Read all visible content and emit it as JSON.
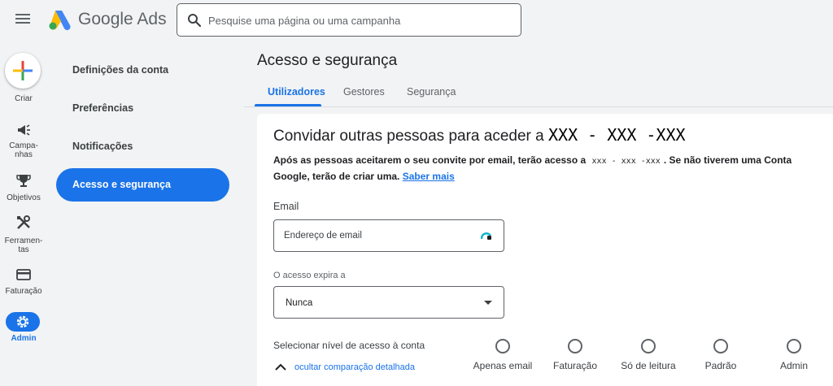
{
  "header": {
    "brand": "Google Ads",
    "search_placeholder": "Pesquise uma página ou uma campanha"
  },
  "rail": {
    "create": "Criar",
    "campaigns_line1": "Campa-",
    "campaigns_line2": "nhas",
    "objectives": "Objetivos",
    "tools_line1": "Ferramen-",
    "tools_line2": "tas",
    "billing": "Faturação",
    "admin": "Admin"
  },
  "subnav": {
    "items": [
      "Definições da conta",
      "Preferências",
      "Notificações"
    ],
    "active": "Acesso e segurança"
  },
  "page": {
    "title": "Acesso e segurança",
    "tabs": [
      "Utilizadores",
      "Gestores",
      "Segurança"
    ]
  },
  "invite": {
    "title_prefix": "Convidar outras pessoas para aceder a",
    "account_id": "XXX - XXX -XXX",
    "desc_part1": "Após as pessoas aceitarem o seu convite por email, terão acesso a",
    "desc_account": "xxx - xxx -xxx",
    "desc_part2": ". Se não tiverem uma Conta Google, terão de criar uma.",
    "learn_more": "Saber mais",
    "email_label": "Email",
    "email_placeholder": "Endereço de email",
    "expiry_label": "O acesso expira a",
    "expiry_value": "Nunca",
    "access_level_label": "Selecionar nível de acesso à conta",
    "hide_comparison": "ocultar comparação detalhada",
    "access_levels": [
      "Apenas email",
      "Faturação",
      "Só de leitura",
      "Padrão",
      "Admin"
    ]
  },
  "colors": {
    "accent": "#1a73e8",
    "background": "#f1f3f4"
  }
}
